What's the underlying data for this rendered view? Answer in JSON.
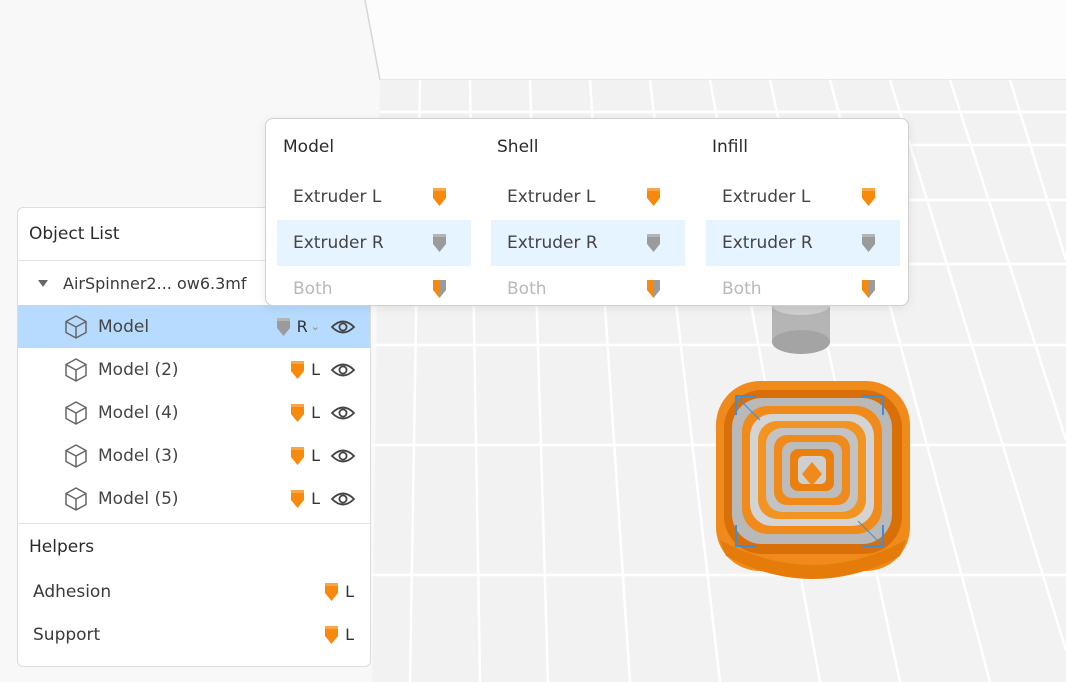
{
  "object_list": {
    "title": "Object List",
    "file_name": "AirSpinner2... ow6.3mf",
    "models": [
      {
        "name": "Model",
        "extruder": "R",
        "nozzle": "gray",
        "selected": true
      },
      {
        "name": "Model (2)",
        "extruder": "L",
        "nozzle": "orange",
        "selected": false
      },
      {
        "name": "Model (4)",
        "extruder": "L",
        "nozzle": "orange",
        "selected": false
      },
      {
        "name": "Model (3)",
        "extruder": "L",
        "nozzle": "orange",
        "selected": false
      },
      {
        "name": "Model (5)",
        "extruder": "L",
        "nozzle": "orange",
        "selected": false
      }
    ],
    "helpers_title": "Helpers",
    "helpers": [
      {
        "name": "Adhesion",
        "extruder": "L"
      },
      {
        "name": "Support",
        "extruder": "L"
      }
    ]
  },
  "extruder_popover": {
    "columns": [
      {
        "title": "Model",
        "options": [
          "Extruder L",
          "Extruder R",
          "Both"
        ],
        "selected": "Extruder R"
      },
      {
        "title": "Shell",
        "options": [
          "Extruder L",
          "Extruder R",
          "Both"
        ],
        "selected": "Extruder R"
      },
      {
        "title": "Infill",
        "options": [
          "Extruder L",
          "Extruder R",
          "Both"
        ],
        "selected": "Extruder R"
      }
    ]
  },
  "colors": {
    "extruder_left": "#f7890c",
    "extruder_right": "#9b9b9b",
    "selection": "#b6dbff",
    "popover_selection": "#e6f4ff",
    "bounding_box": "#3b8fd9"
  },
  "icons": {
    "model": "cube-icon",
    "visibility": "eye-icon",
    "extruder": "nozzle-icon",
    "dropdown": "chevron-down-icon",
    "expand": "caret-down-icon"
  }
}
